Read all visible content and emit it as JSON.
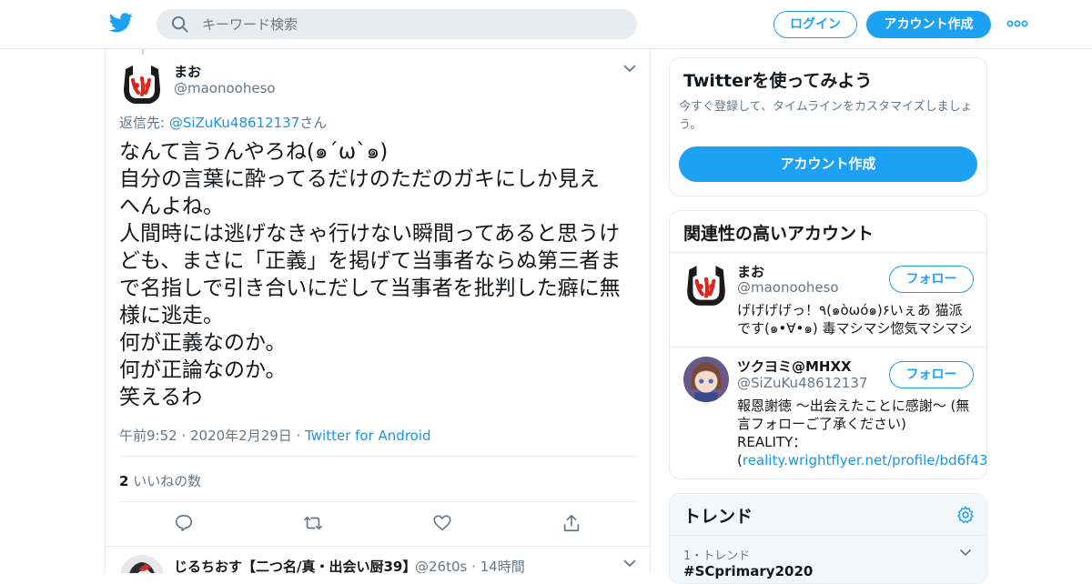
{
  "colors": {
    "accent": "#1da1f2",
    "link": "#1b95e0",
    "muted": "#657786"
  },
  "topbar": {
    "logo_icon": "twitter-bird-icon",
    "search_placeholder": "キーワード検索",
    "login_label": "ログイン",
    "signup_label": "アカウント作成",
    "more_icon": "more-dots-icon"
  },
  "tweet": {
    "author_name": "まお",
    "author_handle": "@maonooheso",
    "reply_prefix": "返信先: ",
    "reply_handle": "@SiZuKu48612137",
    "reply_suffix": "さん",
    "text": "なんて言うんやろね(๑´ω`๑)\n自分の言葉に酔ってるだけのただのガキにしか見え\nへんよね。\n人間時には逃げなきゃ行けない瞬間ってあると思うけ\nども、まさに「正義」を掲げて当事者ならぬ第三者ま\nで名指しで引き合いにだして当事者を批判した癖に無\n様に逃走。\n何が正義なのか。\n何が正論なのか。\n笑えるわ",
    "timestamp": "午前9:52 · 2020年2月29日",
    "dot": " · ",
    "source": "Twitter for Android",
    "like_count": "2",
    "like_label": " いいねの数"
  },
  "next_tweet": {
    "author_name": "じるちおす【二つ名/真・出会い厨39】",
    "author_handle": "@26t0s · 14時間"
  },
  "signup_card": {
    "title": "Twitterを使ってみよう",
    "desc": "今すぐ登録して、タイムラインをカスタマイズしましょう。",
    "button": "アカウント作成"
  },
  "related_card": {
    "title": "関連性の高いアカウント",
    "accounts": [
      {
        "name": "まお",
        "handle": "@maonooheso",
        "follow": "フォロー",
        "bio": "げげげげっ！٩(๑òωó๑)۶いぇあ 猫派です(๑•∀•๑) 毒マシマシ惚気マシマシ"
      },
      {
        "name": "ツクヨミ@MHXX",
        "handle": "@SiZuKu48612137",
        "follow": "フォロー",
        "bio_pre": "報恩謝徳 〜出会えたことに感謝〜 (無言フォローご了承ください) REALITY：(",
        "bio_link": "reality.wrightflyer.net/profile/bd6f43…",
        "bio_post": ")"
      }
    ]
  },
  "trends_card": {
    "title": "トレンド",
    "item_meta": "1・トレンド",
    "item_name": "#SCprimary2020"
  }
}
